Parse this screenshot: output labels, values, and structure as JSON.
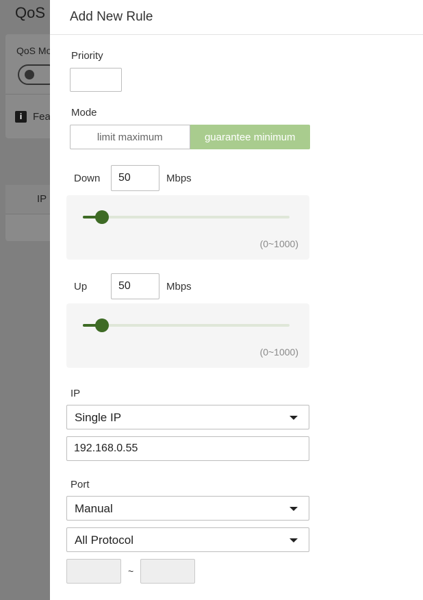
{
  "background": {
    "title": "QoS",
    "mode_label": "QoS Mo",
    "info_text": "Fea",
    "table_header_ip": "IP"
  },
  "panel": {
    "title": "Add New Rule",
    "priority": {
      "label": "Priority",
      "value": ""
    },
    "mode": {
      "label": "Mode",
      "options": [
        "limit maximum",
        "guarantee minimum"
      ],
      "selected": "guarantee minimum"
    },
    "down": {
      "label": "Down",
      "value": "50",
      "unit": "Mbps",
      "range": "(0~1000)",
      "min": 0,
      "max": 1000
    },
    "up": {
      "label": "Up",
      "value": "50",
      "unit": "Mbps",
      "range": "(0~1000)",
      "min": 0,
      "max": 1000
    },
    "ip": {
      "label": "IP",
      "type": "Single IP",
      "address": "192.168.0.55"
    },
    "port": {
      "label": "Port",
      "type": "Manual",
      "protocol": "All Protocol",
      "from": "",
      "to": "",
      "separator": "~"
    }
  },
  "colors": {
    "accent": "#a9cc8e",
    "slider": "#3e6b25"
  }
}
